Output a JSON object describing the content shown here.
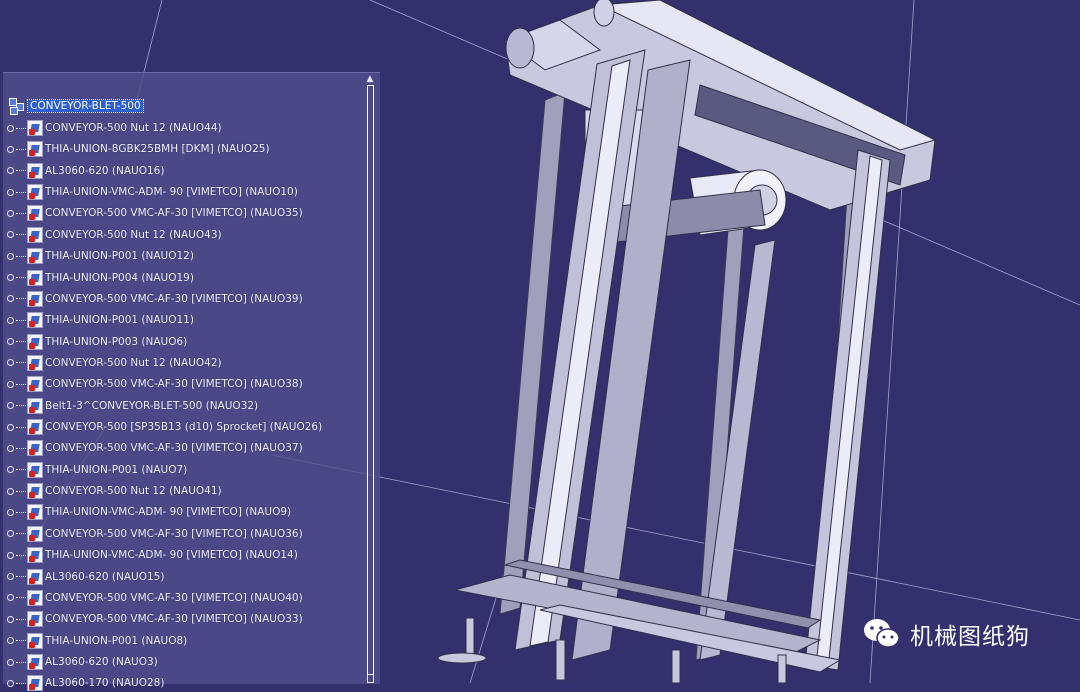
{
  "tree": {
    "root": {
      "label": "CONVEYOR-BLET-500"
    },
    "items": [
      {
        "label": "CONVEYOR-500 Nut 12 (NAUO44)"
      },
      {
        "label": "THIA-UNION-8GBK25BMH [DKM] (NAUO25)"
      },
      {
        "label": "AL3060-620 (NAUO16)"
      },
      {
        "label": "THIA-UNION-VMC-ADM- 90 [VIMETCO] (NAUO10)"
      },
      {
        "label": "CONVEYOR-500 VMC-AF-30 [VIMETCO] (NAUO35)"
      },
      {
        "label": "CONVEYOR-500 Nut 12 (NAUO43)"
      },
      {
        "label": "THIA-UNION-P001 (NAUO12)"
      },
      {
        "label": "THIA-UNION-P004 (NAUO19)"
      },
      {
        "label": "CONVEYOR-500 VMC-AF-30 [VIMETCO] (NAUO39)"
      },
      {
        "label": "THIA-UNION-P001 (NAUO11)"
      },
      {
        "label": "THIA-UNION-P003 (NAUO6)"
      },
      {
        "label": "CONVEYOR-500 Nut 12 (NAUO42)"
      },
      {
        "label": "CONVEYOR-500 VMC-AF-30 [VIMETCO] (NAUO38)"
      },
      {
        "label": "Belt1-3^CONVEYOR-BLET-500 (NAUO32)"
      },
      {
        "label": "CONVEYOR-500 [SP35B13 (d10) Sprocket] (NAUO26)"
      },
      {
        "label": "CONVEYOR-500 VMC-AF-30 [VIMETCO] (NAUO37)"
      },
      {
        "label": "THIA-UNION-P001 (NAUO7)"
      },
      {
        "label": "CONVEYOR-500 Nut 12 (NAUO41)"
      },
      {
        "label": "THIA-UNION-VMC-ADM- 90 [VIMETCO] (NAUO9)"
      },
      {
        "label": "CONVEYOR-500 VMC-AF-30 [VIMETCO] (NAUO36)"
      },
      {
        "label": "THIA-UNION-VMC-ADM- 90 [VIMETCO] (NAUO14)"
      },
      {
        "label": "AL3060-620 (NAUO15)"
      },
      {
        "label": "CONVEYOR-500 VMC-AF-30 [VIMETCO] (NAUO40)"
      },
      {
        "label": "CONVEYOR-500 VMC-AF-30 [VIMETCO] (NAUO33)"
      },
      {
        "label": "THIA-UNION-P001 (NAUO8)"
      },
      {
        "label": "AL3060-620 (NAUO3)"
      },
      {
        "label": "AL3060-170 (NAUO28)"
      }
    ]
  },
  "watermark": {
    "text": "机械图纸狗"
  },
  "colors": {
    "background": "#34306e",
    "frame_light": "#c8c8e0",
    "frame_mid": "#9a9ab8",
    "frame_dark": "#4a4a66",
    "selection": "#2d5fd0"
  },
  "icons": {
    "part": "part-icon",
    "root": "assembly-icon",
    "scroll_up": "scroll-up-arrow-icon",
    "watermark": "wechat-icon"
  }
}
